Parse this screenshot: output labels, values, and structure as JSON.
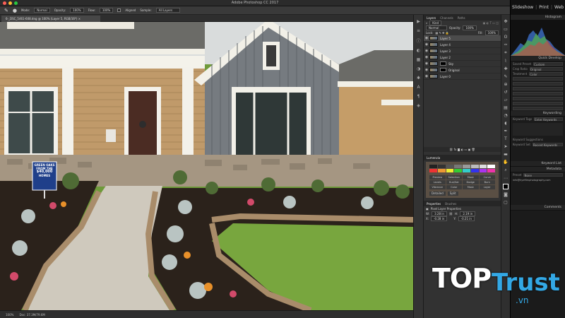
{
  "window": {
    "app_title": "Adobe Photoshop CC 2017"
  },
  "options_bar": {
    "mode_label": "Mode:",
    "mode_value": "Normal",
    "opacity_label": "Opacity:",
    "opacity_value": "100%",
    "flow_label": "Flow:",
    "flow_value": "100%",
    "aligned_label": "Aligned",
    "sample_label": "Sample:",
    "sample_value": "All Layers"
  },
  "document": {
    "tab_label": "6-_DSC_5461-608.dng @ 100% (Layer 5, RGB/16*) ×",
    "zoom": "100%",
    "doc_info": "Doc: 37.3M/79.6M"
  },
  "layers_panel": {
    "tabs": [
      "Layers",
      "Channels",
      "Paths"
    ],
    "kind_label": "Kind",
    "blend_mode": "Normal",
    "opacity_label": "Opacity:",
    "opacity_value": "100%",
    "lock_label": "Lock:",
    "fill_label": "Fill:",
    "fill_value": "100%",
    "layers": [
      {
        "name": "Layer 5",
        "selected": true,
        "mask": false
      },
      {
        "name": "Layer 4",
        "selected": false,
        "mask": false
      },
      {
        "name": "Layer 3",
        "selected": false,
        "mask": false
      },
      {
        "name": "Layer 2",
        "selected": false,
        "mask": false
      },
      {
        "name": "Sky",
        "selected": false,
        "mask": true
      },
      {
        "name": "Original",
        "selected": false,
        "mask": true
      },
      {
        "name": "Layer 0",
        "selected": false,
        "mask": false
      }
    ]
  },
  "lumenzia_panel": {
    "title": "Lumenzia",
    "buttons": [
      "Preview",
      "Selection",
      "Mask",
      "Curve",
      "Levels",
      "Hue/Sat",
      "Dodge",
      "Burn",
      "Vibrance",
      "Color",
      "Mask",
      "Layer"
    ],
    "bottom_labels": [
      "Detailed",
      "Split"
    ]
  },
  "properties_panel": {
    "tabs": [
      "Properties",
      "Brushes"
    ],
    "title": "Pixel Layer Properties",
    "w_label": "W:",
    "w_value": "3.28 in",
    "h_label": "H:",
    "h_value": "2.19 in",
    "x_label": "X:",
    "x_value": "-0.28 in",
    "y_label": "Y:",
    "y_value": "-0.21 in"
  },
  "lightroom": {
    "top_tabs": [
      "Slideshow",
      "Print",
      "Web"
    ],
    "sections": [
      "Histogram",
      "Quick Develop",
      "Keywording",
      "Keyword List",
      "Metadata",
      "Comments"
    ],
    "quick_develop": {
      "saved_preset_label": "Saved Preset",
      "saved_preset_value": "Custom",
      "crop_ratio_label": "Crop Ratio",
      "crop_ratio_value": "Original",
      "treatment_label": "Treatment",
      "treatment_value": "Color"
    },
    "keywording": {
      "keyword_tags_label": "Keyword Tags",
      "keyword_tags_value": "Enter Keywords",
      "suggestions_label": "Keyword Suggestions",
      "set_label": "Keyword Set",
      "set_value": "Recent Keywords"
    },
    "metadata": {
      "preset_label": "Preset",
      "preset_value": "None",
      "email_value": "info@hyefilmphotography.com"
    }
  },
  "canvas": {
    "sign_line1": "GREEN OAKS",
    "sign_line2": "FROM THE",
    "sign_line3": "$40,000",
    "sign_line4": "HOMES"
  },
  "watermark": {
    "word1": "TOP",
    "word2": "Trust",
    "suffix": ".vn"
  },
  "colors": {
    "ps_panel": "#323232",
    "ps_dark": "#262626",
    "accent_blue": "#33a8e5",
    "lawn_green": "#6f9a3a"
  }
}
